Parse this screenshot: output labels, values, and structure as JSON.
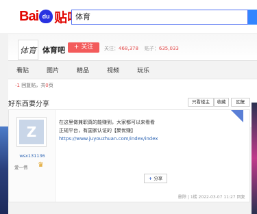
{
  "header": {
    "logo_bai": "Bai",
    "logo_paw": "du",
    "logo_tieba": "贴吧",
    "search_value": "体育"
  },
  "forum": {
    "avatar_text": "体育",
    "name": "体育吧",
    "follow_label": "+ 关注",
    "follow_stat_label": "关注：",
    "follow_count": "468,378",
    "post_stat_label": "贴子：",
    "post_count": "635,033",
    "tabs": [
      "看贴",
      "图片",
      "精品",
      "视频",
      "玩乐"
    ]
  },
  "thread": {
    "reply_count_label": "-1",
    "reply_text": " 回复贴，共",
    "page_count": "0",
    "page_suffix": "页",
    "title": "好东西要分享",
    "btn_only_op": "只看楼主",
    "btn_collect": "收藏",
    "btn_reply": "回复"
  },
  "post": {
    "username": "wsx131136",
    "level_text": "爱一伟",
    "line1": "在这里做兼职真的能赚到，大家都可以来看看",
    "line2": "正规平台，有国家认证的【聚优赚】",
    "link": "https://www.juyouzhuan.com/index/index",
    "share_label": "分享",
    "footer": "删除 | 1楼  2022-03-07 11:27  回复"
  },
  "colors": {
    "accent": "#3385ff",
    "follow": "#f35b5b",
    "link": "#2d64b3"
  }
}
